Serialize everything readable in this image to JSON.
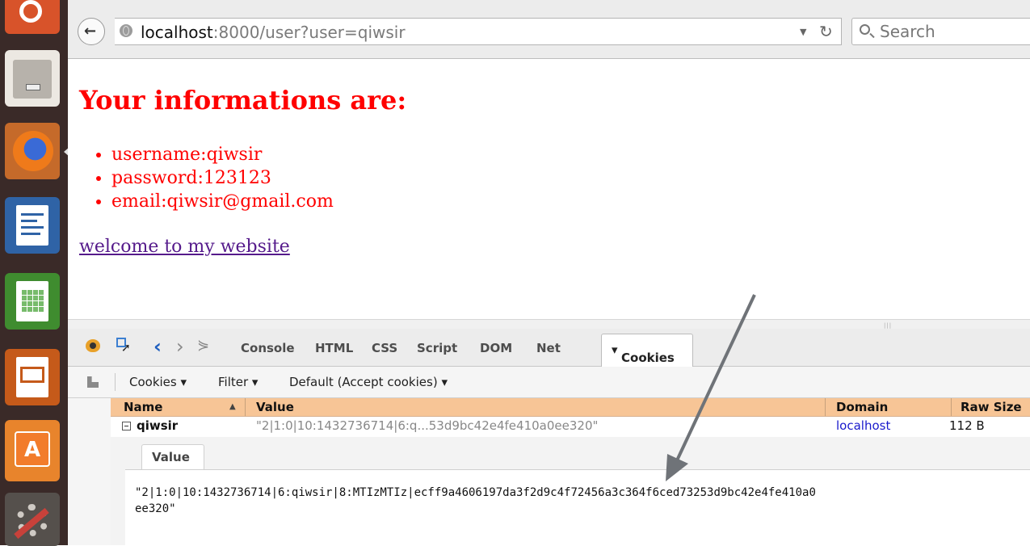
{
  "browser": {
    "url_host": "localhost",
    "url_rest": ":8000/user?user=qiwsir",
    "search_placeholder": "Search"
  },
  "page": {
    "heading": "Your informations are:",
    "info_items": [
      "username:qiwsir",
      "password:123123",
      "email:qiwsir@gmail.com"
    ],
    "link_text": "welcome to my website"
  },
  "firebug": {
    "tabs": [
      "Console",
      "HTML",
      "CSS",
      "Script",
      "DOM",
      "Net"
    ],
    "active_tab": "Cookies",
    "submenus": [
      "Cookies",
      "Filter",
      "Default (Accept cookies)"
    ],
    "columns": [
      "Name",
      "Value",
      "Domain",
      "Raw Size"
    ],
    "cookie": {
      "name": "qiwsir",
      "value": "\"2|1:0|10:1432736714|6:q...53d9bc42e4fe410a0ee320\"",
      "domain": "localhost",
      "raw_size": "112 B"
    },
    "detail_tab": "Value",
    "detail_line1": "\"2|1:0|10:1432736714|6:qiwsir|8:MTIzMTIz|ecff9a4606197da3f2d9c4f72456a3c364f6ced73253d9bc42e4fe410a0",
    "detail_line2": "ee320\""
  },
  "colors": {
    "heading": "#ff0000",
    "link": "#551a8b",
    "column_header": "#f7c596",
    "domain_link": "#1a1acc"
  }
}
